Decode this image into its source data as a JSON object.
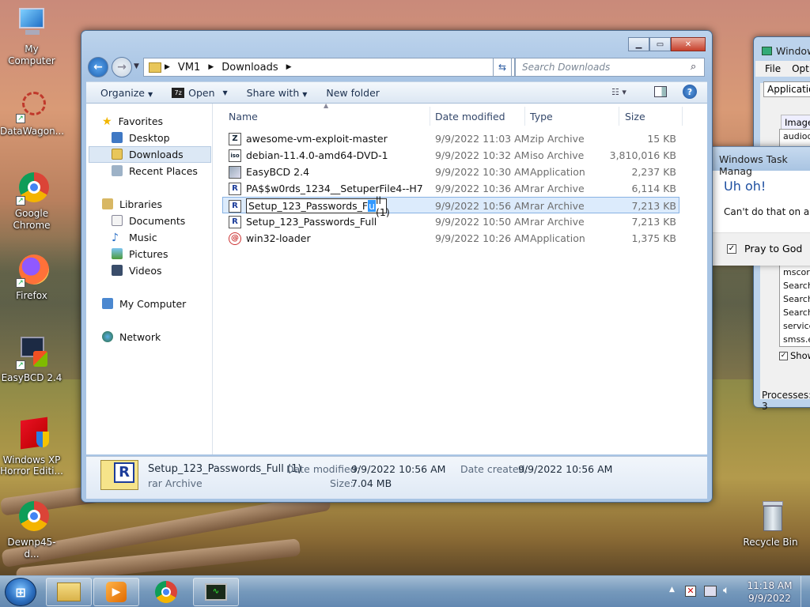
{
  "desktop": {
    "icons": [
      {
        "label": "My Computer"
      },
      {
        "label": "DataWagon..."
      },
      {
        "label": "Google Chrome"
      },
      {
        "label": "Firefox"
      },
      {
        "label": "EasyBCD 2.4"
      },
      {
        "label": "Windows XP Horror Editi..."
      },
      {
        "label": "Dewnp45-d..."
      },
      {
        "label": "Recycle Bin"
      }
    ]
  },
  "explorer": {
    "breadcrumb": [
      "VM1",
      "Downloads"
    ],
    "search_placeholder": "Search Downloads",
    "toolbar": {
      "organize": "Organize",
      "open": "Open",
      "share": "Share with",
      "new_folder": "New folder"
    },
    "nav": {
      "favorites": "Favorites",
      "desktop": "Desktop",
      "downloads": "Downloads",
      "recent": "Recent Places",
      "libraries": "Libraries",
      "documents": "Documents",
      "music": "Music",
      "pictures": "Pictures",
      "videos": "Videos",
      "computer": "My Computer",
      "network": "Network"
    },
    "columns": {
      "name": "Name",
      "date": "Date modified",
      "type": "Type",
      "size": "Size"
    },
    "files": [
      {
        "name": "awesome-vm-exploit-master",
        "date": "9/9/2022 11:03 AM",
        "type": "zip Archive",
        "size": "15 KB",
        "icon": "Z"
      },
      {
        "name": "debian-11.4.0-amd64-DVD-1",
        "date": "9/9/2022 10:32 AM",
        "type": "iso Archive",
        "size": "3,810,016 KB",
        "icon": "iso"
      },
      {
        "name": "EasyBCD 2.4",
        "date": "9/9/2022 10:30 AM",
        "type": "Application",
        "size": "2,237 KB",
        "icon": "app"
      },
      {
        "name": "PA$$w0rds_1234__SetuperFile4--H7",
        "date": "9/9/2022 10:36 AM",
        "type": "rar Archive",
        "size": "6,114 KB",
        "icon": "R"
      },
      {
        "name": "Setup_123_Passwords_Full (1)",
        "date": "9/9/2022 10:56 AM",
        "type": "rar Archive",
        "size": "7,213 KB",
        "icon": "R"
      },
      {
        "name": "Setup_123_Passwords_Full",
        "date": "9/9/2022 10:50 AM",
        "type": "rar Archive",
        "size": "7,213 KB",
        "icon": "R"
      },
      {
        "name": "win32-loader",
        "date": "9/9/2022 10:26 AM",
        "type": "Application",
        "size": "1,375 KB",
        "icon": "app"
      }
    ],
    "rename": {
      "before": "Setup_123_Passwords_F",
      "cursor": "u",
      "after": "ll (1)"
    },
    "details": {
      "name": "Setup_123_Passwords_Full (1)",
      "type": "rar Archive",
      "modified_label": "Date modified:",
      "modified": "9/9/2022 10:56 AM",
      "created_label": "Date created:",
      "created": "9/9/2022 10:56 AM",
      "size_label": "Size:",
      "size": "7.04 MB"
    }
  },
  "taskmgr": {
    "title": "Window",
    "menu": [
      "File",
      "Optio"
    ],
    "tab": "Application",
    "col": "Image",
    "rows": [
      "audiodc",
      "mscors",
      "Search",
      "Search",
      "Search",
      "service",
      "smss.e"
    ],
    "show": "Show",
    "processes": "Processes: 3"
  },
  "dialog": {
    "title": "Windows Task Manag",
    "heading": "Uh oh!",
    "text": "Can't do that on a Ch",
    "checkbox": "Pray to God"
  },
  "clock": {
    "time": "11:18 AM",
    "date": "9/9/2022"
  }
}
